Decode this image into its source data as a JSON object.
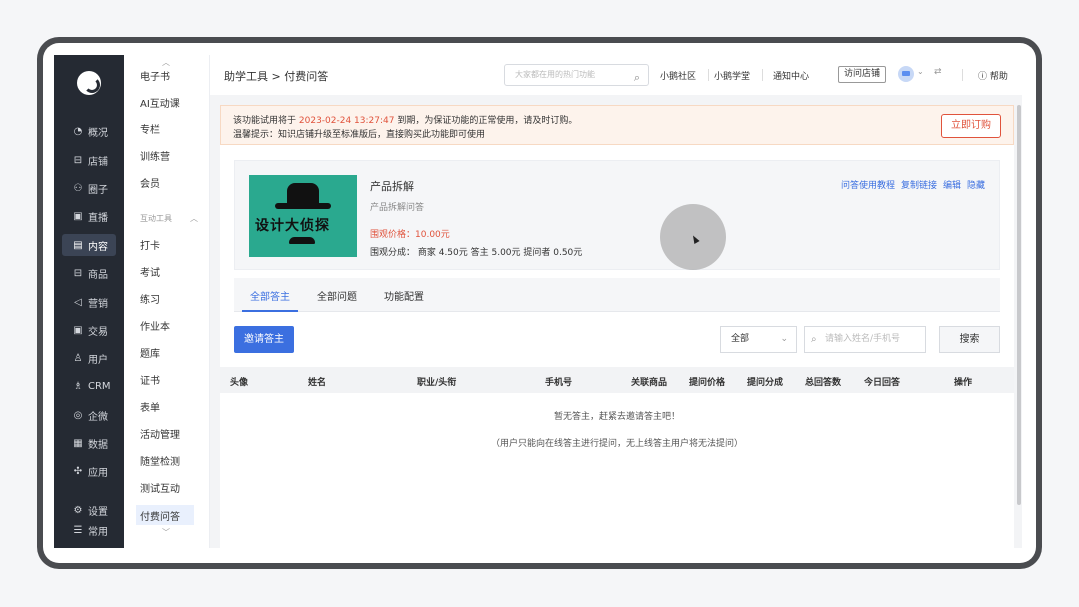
{
  "nav_primary": [
    {
      "icon": "overview-icon",
      "glyph": "◔",
      "label": "概况"
    },
    {
      "icon": "store-icon",
      "glyph": "⊟",
      "label": "店铺"
    },
    {
      "icon": "community-icon",
      "glyph": "⚇",
      "label": "圈子"
    },
    {
      "icon": "live-icon",
      "glyph": "▣",
      "label": "直播"
    },
    {
      "icon": "content-icon",
      "glyph": "▤",
      "label": "内容",
      "active": true
    },
    {
      "icon": "goods-icon",
      "glyph": "⊟",
      "label": "商品"
    },
    {
      "icon": "marketing-icon",
      "glyph": "◁",
      "label": "营销"
    },
    {
      "icon": "trade-icon",
      "glyph": "▣",
      "label": "交易"
    },
    {
      "icon": "user-icon",
      "glyph": "♙",
      "label": "用户"
    },
    {
      "icon": "crm-icon",
      "glyph": "♗",
      "label": "CRM"
    },
    {
      "icon": "wecom-icon",
      "glyph": "◎",
      "label": "企微"
    },
    {
      "icon": "data-icon",
      "glyph": "▦",
      "label": "数据"
    },
    {
      "icon": "apps-icon",
      "glyph": "✣",
      "label": "应用"
    }
  ],
  "nav_bottom": [
    {
      "icon": "settings-icon",
      "glyph": "⚙",
      "label": "设置"
    },
    {
      "icon": "common-icon",
      "glyph": "☰",
      "label": "常用"
    }
  ],
  "nav_secondary": {
    "top_items": [
      "电子书",
      "AI互动课",
      "专栏",
      "训练营",
      "会员"
    ],
    "group_label": "互动工具",
    "group_items": [
      "打卡",
      "考试",
      "练习",
      "作业本",
      "题库",
      "证书",
      "表单",
      "活动管理",
      "随堂检测",
      "测试互动",
      "付费问答"
    ],
    "active": "付费问答"
  },
  "topbar": {
    "breadcrumb": "助学工具 > 付费问答",
    "search_placeholder": "大家都在用的热门功能",
    "links": [
      "小鹅社区",
      "小鹅学堂",
      "通知中心"
    ],
    "visit_store": "访问店铺",
    "help": "帮助"
  },
  "notice": {
    "line1_prefix": "该功能试用将于",
    "date": "2023-02-24 13:27:47",
    "line1_suffix": "到期，为保证功能的正常使用，请及时订购。",
    "line2": "温馨提示：知识店铺升级至标准版后，直接购买此功能即可使用",
    "button": "立即订购"
  },
  "product": {
    "cover_text": "设计大侦探",
    "title": "产品拆解",
    "subtitle": "产品拆解问答",
    "price": "围观价格：10.00元",
    "share": "围观分成： 商家 4.50元 答主 5.00元 提问者 0.50元",
    "links": [
      "问答使用教程",
      "复制链接",
      "编辑",
      "隐藏"
    ]
  },
  "tabs": [
    "全部答主",
    "全部问题",
    "功能配置"
  ],
  "filters": {
    "invite_button": "邀请答主",
    "select_value": "全部",
    "search_placeholder": "请输入姓名/手机号",
    "search_button": "搜索"
  },
  "table": {
    "columns": [
      "头像",
      "姓名",
      "职业/头衔",
      "手机号",
      "关联商品",
      "提问价格",
      "提问分成",
      "总回答数",
      "今日回答",
      "操作"
    ],
    "empty_line1": "暂无答主，赶紧去邀请答主吧！",
    "empty_line2": "（用户只能向在线答主进行提问，无上线答主用户将无法提问）"
  },
  "colors": {
    "accent": "#3b6fe0",
    "warning": "#e0533c",
    "sidebar": "#252a33"
  }
}
